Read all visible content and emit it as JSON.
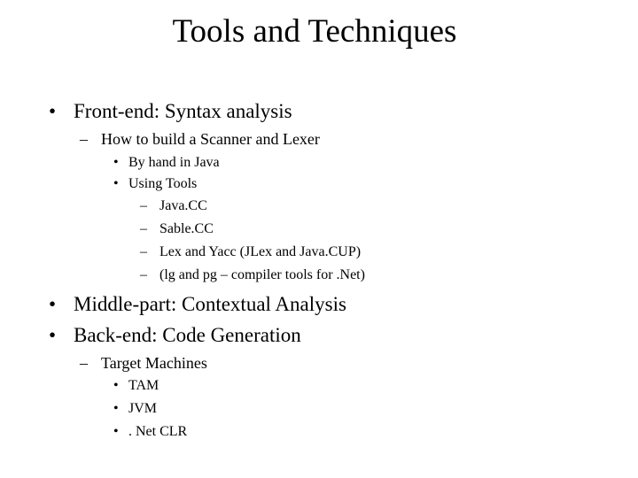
{
  "slide": {
    "title": "Tools and Techniques",
    "bullets": {
      "b1": {
        "marker": "•",
        "text": "Front-end: Syntax analysis"
      },
      "b1_1": {
        "marker": "–",
        "text": "How to build a Scanner and Lexer"
      },
      "b1_1_1": {
        "marker": "•",
        "text": "By hand in Java"
      },
      "b1_1_2": {
        "marker": "•",
        "text": "Using Tools"
      },
      "b1_1_2_1": {
        "marker": "–",
        "text": "Java.CC"
      },
      "b1_1_2_2": {
        "marker": "–",
        "text": "Sable.CC"
      },
      "b1_1_2_3": {
        "marker": "–",
        "text": "Lex and Yacc (JLex and Java.CUP)"
      },
      "b1_1_2_4": {
        "marker": "–",
        "text": "(lg and pg – compiler tools for .Net)"
      },
      "b2": {
        "marker": "•",
        "text": "Middle-part: Contextual Analysis"
      },
      "b3": {
        "marker": "•",
        "text": "Back-end: Code Generation"
      },
      "b3_1": {
        "marker": "–",
        "text": "Target Machines"
      },
      "b3_1_1": {
        "marker": "•",
        "text": "TAM"
      },
      "b3_1_2": {
        "marker": "•",
        "text": "JVM"
      },
      "b3_1_3": {
        "marker": "•",
        "text": ". Net CLR"
      }
    }
  }
}
